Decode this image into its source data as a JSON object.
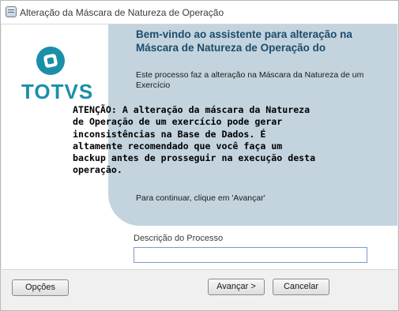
{
  "window": {
    "title": "Alteração da Máscara de Natureza de Operação"
  },
  "logo": {
    "text": "TOTVS",
    "icon": "totvs-logo-icon",
    "brand_color": "#1b8fa8"
  },
  "wizard": {
    "welcome_title": "Bem-vindo ao assistente para alteração na Máscara de Natureza de Operação do",
    "description": "Este processo faz a alteração na Máscara da Natureza de um Exercício",
    "warning": "ATENÇÃO: A alteração da máscara da Natureza de Operação de um exercício pode gerar inconsistências na Base de Dados. É altamente recomendado que você faça um backup antes de prosseguir na execução desta operação.",
    "continue_hint": "Para continuar, clique em 'Avançar'",
    "panel_color": "#c3d4de"
  },
  "form": {
    "process_description_label": "Descrição do Processo",
    "process_description_value": ""
  },
  "buttons": {
    "options": "Opções",
    "next": "Avançar >",
    "cancel": "Cancelar"
  }
}
